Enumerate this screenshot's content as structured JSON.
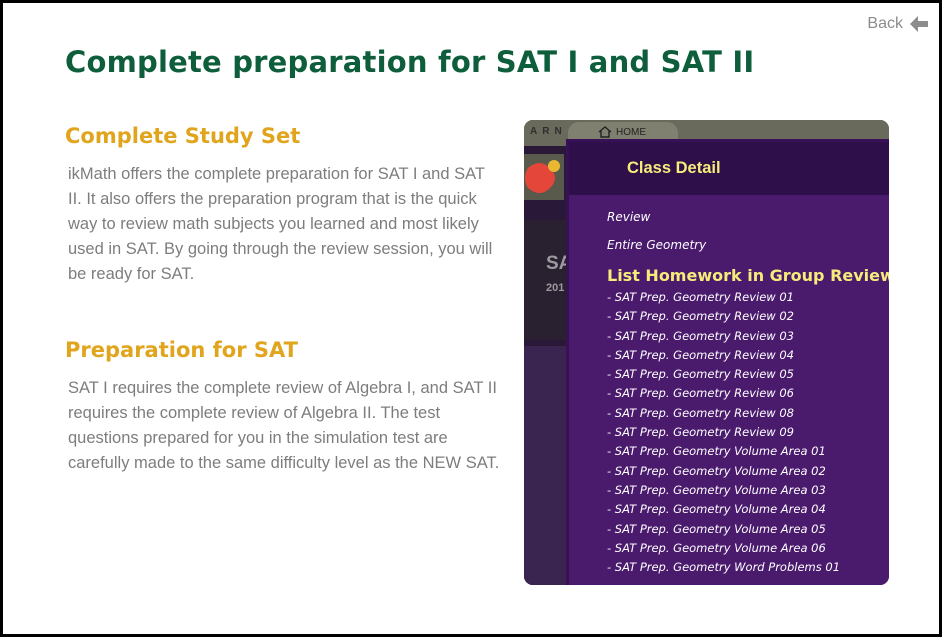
{
  "nav": {
    "back_label": "Back"
  },
  "page": {
    "title": "Complete preparation for SAT I and SAT II"
  },
  "sections": [
    {
      "heading": "Complete Study Set",
      "body": "ikMath offers the complete preparation for SAT I and SAT II. It also offers the preparation program that is the quick way to review math subjects you learned and most likely used in SAT. By going through the review session, you will be ready for SAT."
    },
    {
      "heading": "Preparation for SAT",
      "body": "SAT I requires the complete review of Algebra I, and SAT II requires the complete review of Algebra II. The test questions prepared for you in the simulation test are carefully made to the same difficulty level as the NEW SAT."
    }
  ],
  "screenshot": {
    "brand": "ARN",
    "home_label": "HOME",
    "background_title": "SA",
    "background_subtitle": "201",
    "dialog": {
      "title": "Class Detail",
      "meta1": "Review",
      "meta2": "Entire Geometry",
      "list_title": "List Homework in Group Review Geo",
      "items": [
        "- SAT Prep. Geometry Review 01",
        "- SAT Prep. Geometry Review 02",
        "- SAT Prep. Geometry Review 03",
        "- SAT Prep. Geometry Review 04",
        "- SAT Prep. Geometry Review 05",
        "- SAT Prep. Geometry Review 06",
        "- SAT Prep. Geometry Review 08",
        "- SAT Prep. Geometry Review 09",
        "- SAT Prep. Geometry Volume Area 01",
        "- SAT Prep. Geometry Volume Area 02",
        "- SAT Prep. Geometry Volume Area 03",
        "- SAT Prep. Geometry Volume Area 04",
        "- SAT Prep. Geometry Volume Area 05",
        "- SAT Prep. Geometry Volume Area 06",
        "- SAT Prep. Geometry Word Problems 01"
      ]
    }
  },
  "colors": {
    "title": "#0e5e3c",
    "heading": "#e0a51c",
    "body_text": "#7d7d7d",
    "dialog_bg": "#4a1a6d",
    "dialog_accent": "#f6ec7a"
  },
  "icons": {
    "back": "arrow-left-icon",
    "home": "home-icon"
  }
}
